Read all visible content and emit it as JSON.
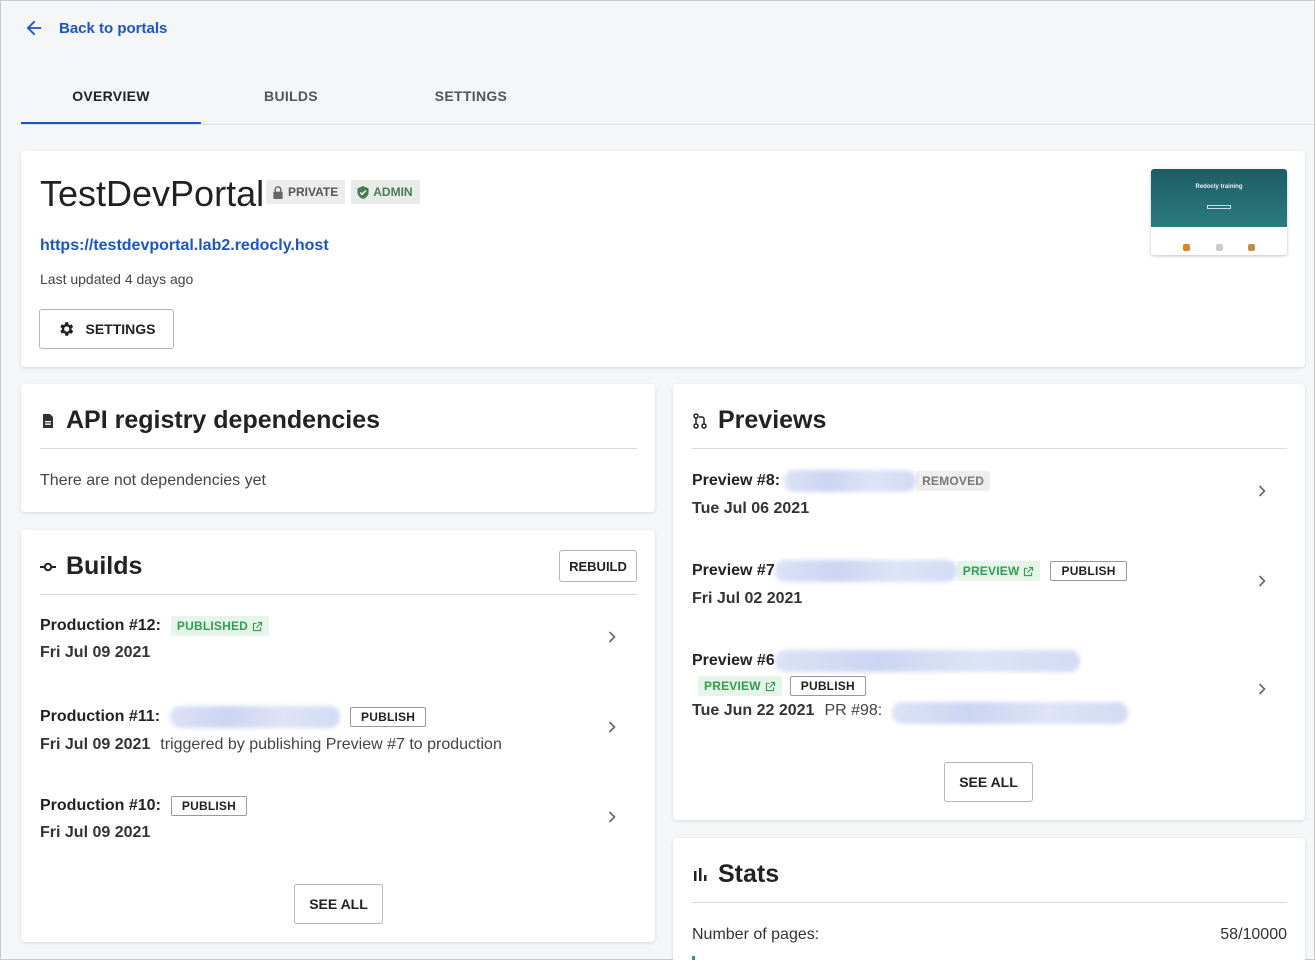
{
  "nav": {
    "back_label": "Back to portals"
  },
  "tabs": [
    {
      "label": "OVERVIEW",
      "active": true
    },
    {
      "label": "BUILDS",
      "active": false
    },
    {
      "label": "SETTINGS",
      "active": false
    }
  ],
  "portal": {
    "title": "TestDevPortal",
    "badge_private": "PRIVATE",
    "badge_admin": "ADMIN",
    "url": "https://testdevportal.lab2.redocly.host",
    "updated": "Last updated 4 days ago",
    "settings_label": "SETTINGS",
    "thumbnail_title": "Redocly training"
  },
  "api_registry": {
    "title": "API registry dependencies",
    "empty_text": "There are not dependencies yet"
  },
  "builds": {
    "title": "Builds",
    "rebuild_label": "REBUILD",
    "items": [
      {
        "label": "Production #12:",
        "tag": "PUBLISHED",
        "date": "Fri Jul 09 2021",
        "note": ""
      },
      {
        "label": "Production #11:",
        "tag": "PUBLISH",
        "date": "Fri Jul 09 2021",
        "note": "triggered by publishing Preview #7 to production"
      },
      {
        "label": "Production #10:",
        "tag": "PUBLISH",
        "date": "Fri Jul 09 2021",
        "note": ""
      }
    ],
    "see_all_label": "SEE ALL"
  },
  "previews": {
    "title": "Previews",
    "items": [
      {
        "label": "Preview #8:",
        "tag": "REMOVED",
        "date": "Tue Jul 06 2021"
      },
      {
        "label": "Preview #7",
        "tag_preview": "PREVIEW",
        "tag_publish": "PUBLISH",
        "date": "Fri Jul 02 2021"
      },
      {
        "label": "Preview #6",
        "tag_preview": "PREVIEW",
        "tag_publish": "PUBLISH",
        "date": "Tue Jun 22 2021",
        "pr": "PR #98:"
      }
    ],
    "see_all_label": "SEE ALL"
  },
  "stats": {
    "title": "Stats",
    "pages_label": "Number of pages:",
    "pages_value": "58/10000",
    "pages_fraction": 0.0058
  },
  "colors": {
    "accent": "#1a56c4",
    "success": "#2e9e4f",
    "background": "#f4f6f7"
  }
}
